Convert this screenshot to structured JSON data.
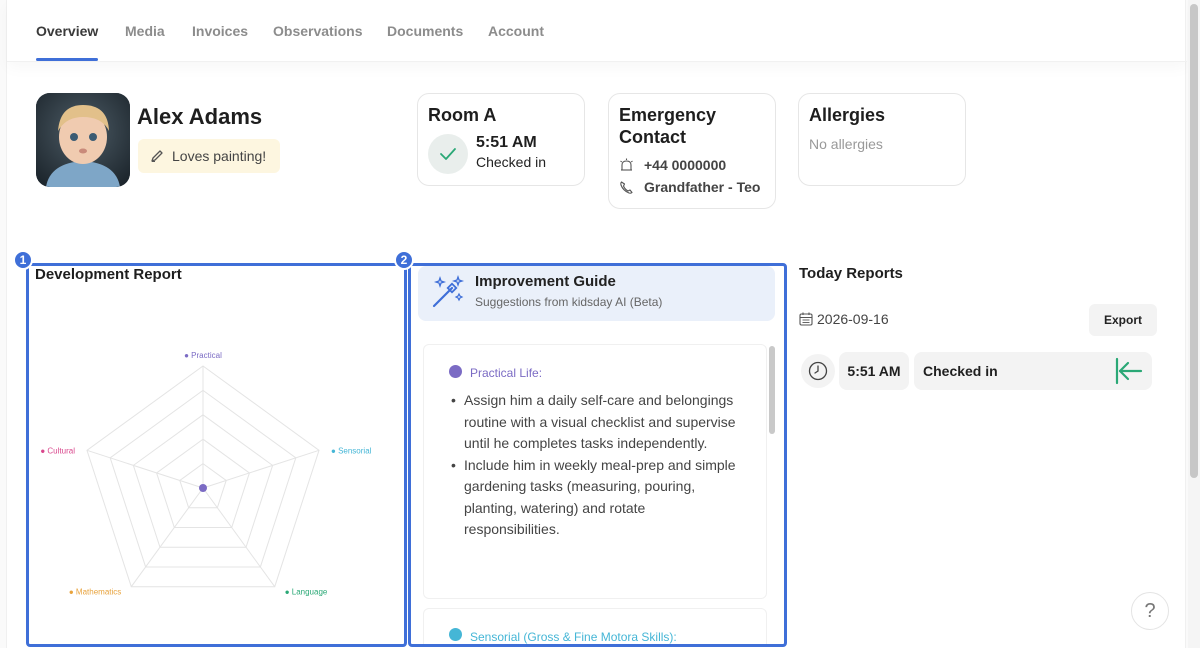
{
  "tabs": [
    {
      "label": "Overview",
      "active": true
    },
    {
      "label": "Media"
    },
    {
      "label": "Invoices"
    },
    {
      "label": "Observations"
    },
    {
      "label": "Documents"
    },
    {
      "label": "Account"
    }
  ],
  "child": {
    "name": "Alex Adams",
    "note": "Loves painting!"
  },
  "room_card": {
    "title": "Room A",
    "time": "5:51 AM",
    "status": "Checked in"
  },
  "emergency_card": {
    "title_line1": "Emergency",
    "title_line2": "Contact",
    "phone": "+44 0000000",
    "relation": "Grandfather - Teo"
  },
  "allergies_card": {
    "title": "Allergies",
    "value": "No allergies"
  },
  "markers": {
    "one": "1",
    "two": "2"
  },
  "development_report": {
    "title": "Development Report",
    "axes": [
      {
        "label": "Practical",
        "color": "#7b6bc4"
      },
      {
        "label": "Sensorial",
        "color": "#45b6d6"
      },
      {
        "label": "Language",
        "color": "#2aa876"
      },
      {
        "label": "Mathematics",
        "color": "#e8a33d"
      },
      {
        "label": "Cultural",
        "color": "#d9478c"
      }
    ]
  },
  "improvement_guide": {
    "title": "Improvement Guide",
    "subtitle": "Suggestions from kidsday AI (Beta)",
    "categories": [
      {
        "label": "Practical Life:",
        "color": "#7b6bc4",
        "items": [
          "Assign him a daily self-care and belongings routine with a visual checklist and supervise until he completes tasks independently.",
          "Include him in weekly meal-prep and simple gardening tasks (measuring, pouring, planting, watering) and rotate responsibilities."
        ]
      },
      {
        "label": "Sensorial (Gross & Fine Motora Skills):",
        "color": "#45b6d6"
      }
    ]
  },
  "reports": {
    "title": "Today Reports",
    "date": "2026-09-16",
    "export_label": "Export",
    "entry_time": "5:51 AM",
    "entry_status": "Checked in"
  },
  "help": {
    "label": "?"
  },
  "colors": {
    "accent": "#3f6fd8",
    "checkin_green": "#2aa876",
    "note_bg": "#fdf6e0",
    "guide_header_bg": "#eaf0fa"
  }
}
